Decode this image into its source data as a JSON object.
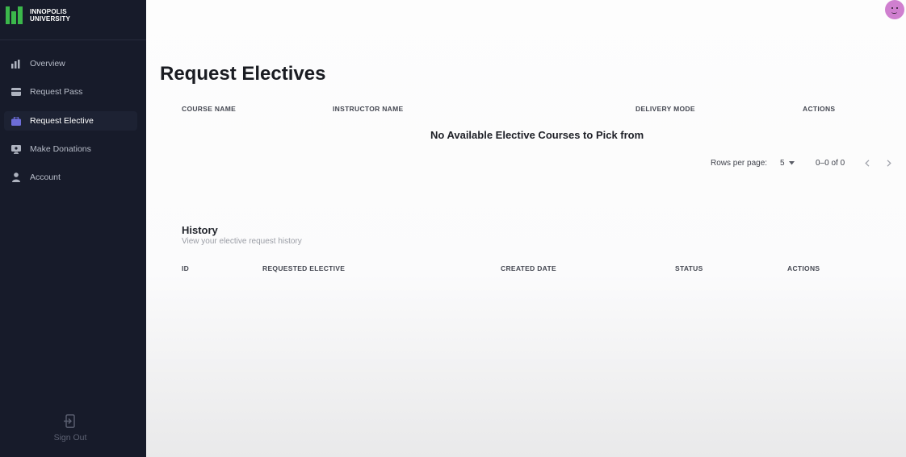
{
  "brand": {
    "line1": "INNOPOLIS",
    "line2": "UNIVERSITY"
  },
  "colors": {
    "sidebar_bg": "#171b2a",
    "logo_green": "#3bb74b",
    "active_icon": "#6d6dd8",
    "avatar": "#cf7fcf"
  },
  "sidebar": {
    "items": [
      {
        "label": "Overview",
        "icon": "bar-chart-icon",
        "active": false
      },
      {
        "label": "Request Pass",
        "icon": "card-icon",
        "active": false
      },
      {
        "label": "Request Elective",
        "icon": "briefcase-icon",
        "active": true
      },
      {
        "label": "Make Donations",
        "icon": "monitor-icon",
        "active": false
      },
      {
        "label": "Account",
        "icon": "person-icon",
        "active": false
      }
    ],
    "sign_out": "Sign Out"
  },
  "page": {
    "title": "Request Electives"
  },
  "electives_table": {
    "columns": [
      "COURSE NAME",
      "INSTRUCTOR NAME",
      "DELIVERY MODE",
      "ACTIONS"
    ],
    "empty_message": "No Available Elective Courses to Pick from",
    "rows_per_page_label": "Rows per page:",
    "rows_per_page_value": "5",
    "range_text": "0–0 of 0"
  },
  "history": {
    "title": "History",
    "subtitle": "View your elective request history",
    "columns": [
      "ID",
      "REQUESTED ELECTIVE",
      "CREATED DATE",
      "STATUS",
      "ACTIONS"
    ]
  }
}
